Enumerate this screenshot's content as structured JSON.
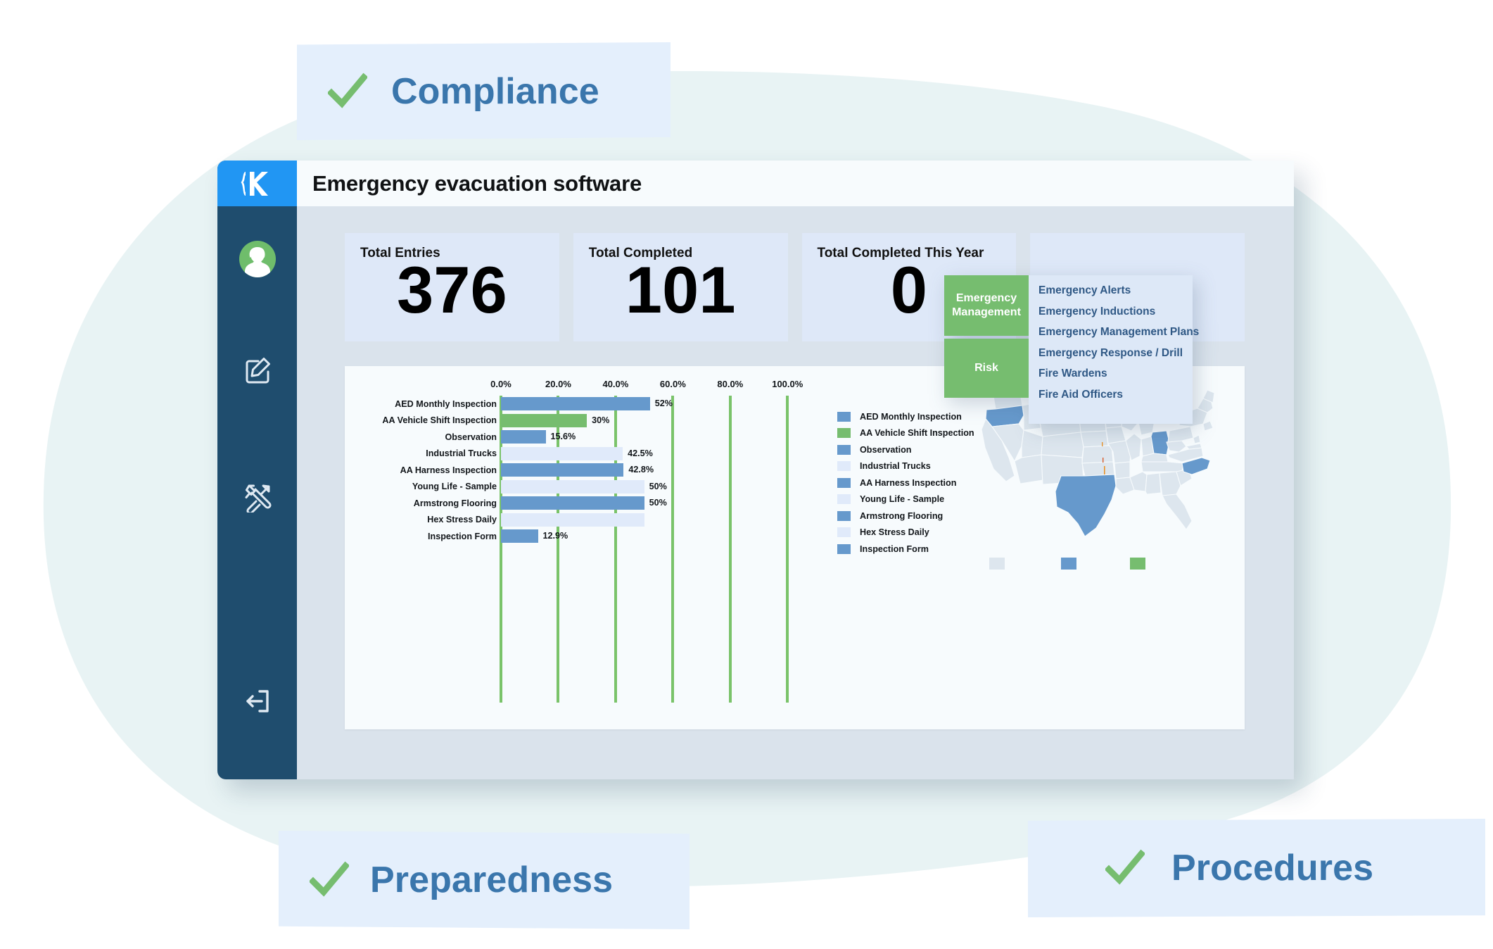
{
  "pills": [
    {
      "id": "compliance",
      "label": "Compliance",
      "icon": "check-icon"
    },
    {
      "id": "preparedness",
      "label": "Preparedness",
      "icon": "check-icon"
    },
    {
      "id": "procedures",
      "label": "Procedures",
      "icon": "check-icon"
    }
  ],
  "window": {
    "title": "Emergency evacuation software",
    "brand_icon": "kiosk-logo-icon"
  },
  "sidebar": {
    "items": [
      {
        "name": "avatar",
        "icon": "user-avatar-icon"
      },
      {
        "name": "edit",
        "icon": "edit-square-icon"
      },
      {
        "name": "tools",
        "icon": "tools-icon"
      },
      {
        "name": "logout",
        "icon": "logout-icon"
      }
    ]
  },
  "kpis": [
    {
      "label": "Total Entries",
      "value": "376"
    },
    {
      "label": "Total Completed",
      "value": "101"
    },
    {
      "label": "Total Completed This Year",
      "value": "0"
    },
    {
      "label": "",
      "value": ""
    }
  ],
  "nav_flyout": {
    "categories": [
      {
        "label": "Emergency Management"
      },
      {
        "label": "Risk"
      }
    ],
    "items": [
      "Emergency Alerts",
      "Emergency Inductions",
      "Emergency Management Plans",
      "Emergency Response / Drill",
      "Fire Wardens",
      "Fire Aid Officers"
    ]
  },
  "colors": {
    "accent_blue": "#2196f3",
    "sidebar": "#1f4d6e",
    "brand_green": "#76bd6f",
    "bar_blue": "#6699cc",
    "bar_green": "#76bd6f",
    "bar_pale": "#e0eafa",
    "pill_bg": "#e4effc",
    "pill_text": "#3a76ac",
    "kpi_bg": "#dee8f8",
    "map_pale": "#dde6ee",
    "map_blue": "#6699cc"
  },
  "chart_data": {
    "type": "bar",
    "orientation": "horizontal",
    "title": "",
    "xlabel": "",
    "ylabel": "",
    "xlim": [
      0,
      110
    ],
    "grid": true,
    "gridline_color": "#7ac36a",
    "xticks": [
      "0.0%",
      "20.0%",
      "40.0%",
      "60.0%",
      "80.0%",
      "100.0%"
    ],
    "xtick_values": [
      0,
      20,
      40,
      60,
      80,
      100
    ],
    "categories": [
      "AED Monthly Inspection",
      "AA Vehicle Shift Inspection",
      "Observation",
      "Industrial Trucks",
      "AA Harness Inspection",
      "Young Life - Sample",
      "Armstrong Flooring",
      "Hex Stress Daily",
      "Inspection Form"
    ],
    "values": [
      52,
      30,
      15.6,
      42.5,
      42.8,
      50,
      50,
      50,
      12.9
    ],
    "value_labels": [
      "52%",
      "30%",
      "15.6%",
      "42.5%",
      "42.8%",
      "50%",
      "50%",
      "",
      "12.9%"
    ],
    "bar_colors": [
      "#6699cc",
      "#76bd6f",
      "#6699cc",
      "#e0eafa",
      "#6699cc",
      "#e0eafa",
      "#6699cc",
      "#e0eafa",
      "#6699cc"
    ],
    "legend_position": "right",
    "legend": [
      {
        "label": "AED Monthly Inspection",
        "color": "#6699cc"
      },
      {
        "label": "AA Vehicle Shift Inspection",
        "color": "#76bd6f"
      },
      {
        "label": "Observation",
        "color": "#6699cc"
      },
      {
        "label": "Industrial Trucks",
        "color": "#e0eafa"
      },
      {
        "label": "AA Harness Inspection",
        "color": "#6699cc"
      },
      {
        "label": "Young Life - Sample",
        "color": "#e0eafa"
      },
      {
        "label": "Armstrong Flooring",
        "color": "#6699cc"
      },
      {
        "label": "Hex Stress Daily",
        "color": "#e0eafa"
      },
      {
        "label": "Inspection Form",
        "color": "#6699cc"
      }
    ]
  },
  "map": {
    "type": "choropleth",
    "region": "United States",
    "highlighted_states": [
      "Oregon",
      "Texas",
      "Ohio",
      "North Carolina"
    ],
    "legend_swatches": [
      "#dde6ee",
      "#6699cc",
      "#76bd6f"
    ]
  }
}
